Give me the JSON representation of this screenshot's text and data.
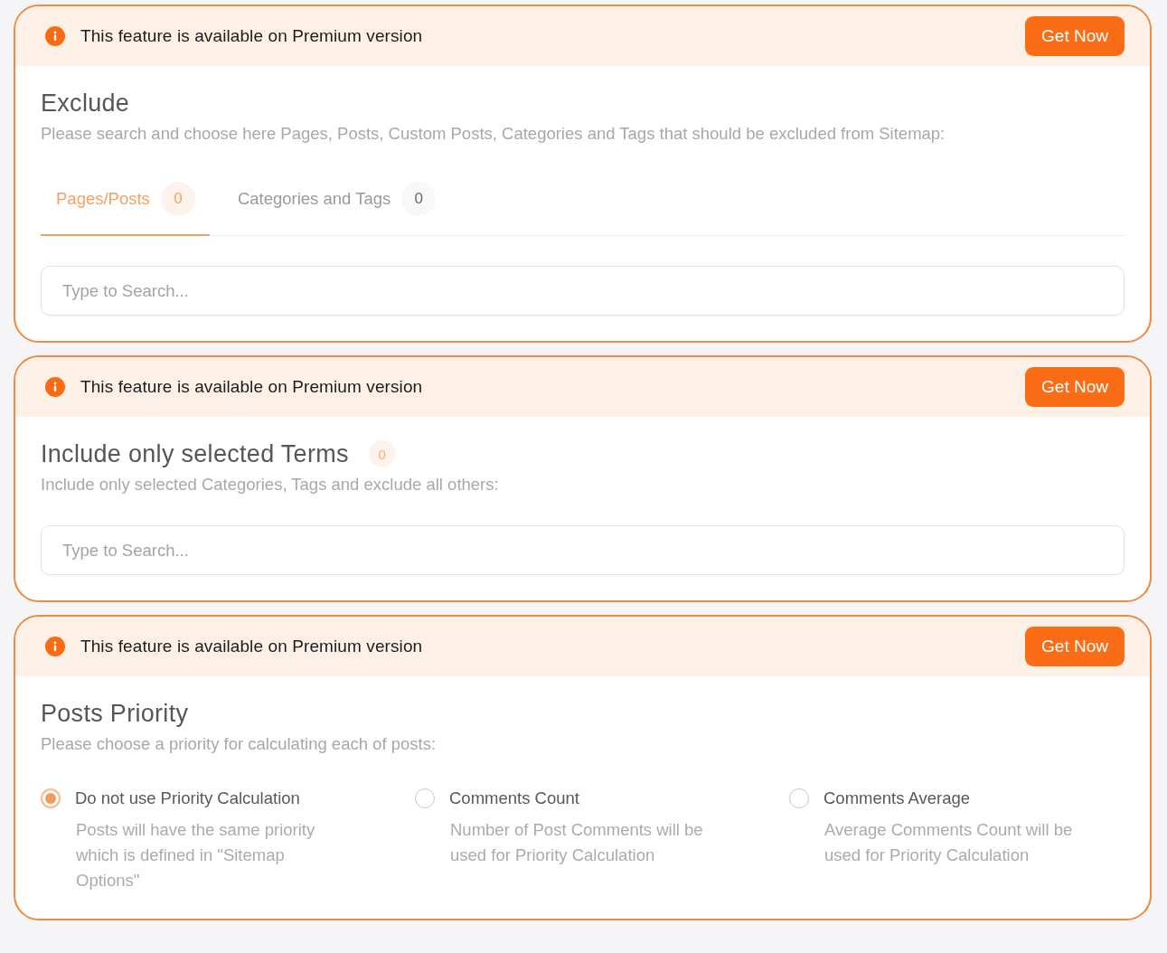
{
  "panels": [
    {
      "kind": "tabbed",
      "banner": {
        "message": "This feature is available on Premium version",
        "button": "Get Now"
      },
      "title": "Exclude",
      "description": "Please search and choose here Pages, Posts, Custom Posts, Categories and Tags that should be excluded from Sitemap:",
      "tabs": [
        {
          "label": "Pages/Posts",
          "count": "0",
          "selected": true
        },
        {
          "label": "Categories and Tags",
          "count": "0",
          "selected": false
        }
      ],
      "search": {
        "placeholder": "Type to Search..."
      }
    },
    {
      "kind": "search",
      "banner": {
        "message": "This feature is available on Premium version",
        "button": "Get Now"
      },
      "title": "Include only selected Terms",
      "title_count": "0",
      "description": "Include only selected Categories, Tags and exclude all others:",
      "search": {
        "placeholder": "Type to Search..."
      }
    },
    {
      "kind": "options",
      "banner": {
        "message": "This feature is available on Premium version",
        "button": "Get Now"
      },
      "title": "Posts Priority",
      "description": "Please choose a priority for calculating each of posts:",
      "options": [
        {
          "label": "Do not use Priority Calculation",
          "description": "Posts will have the same priority which is defined in \"Sitemap Options\"",
          "selected": true
        },
        {
          "label": "Comments Count",
          "description": "Number of Post Comments will be used for Priority Calculation",
          "selected": false
        },
        {
          "label": "Comments Average",
          "description": "Average Comments Count will be used for Priority Calculation",
          "selected": false
        }
      ]
    }
  ]
}
